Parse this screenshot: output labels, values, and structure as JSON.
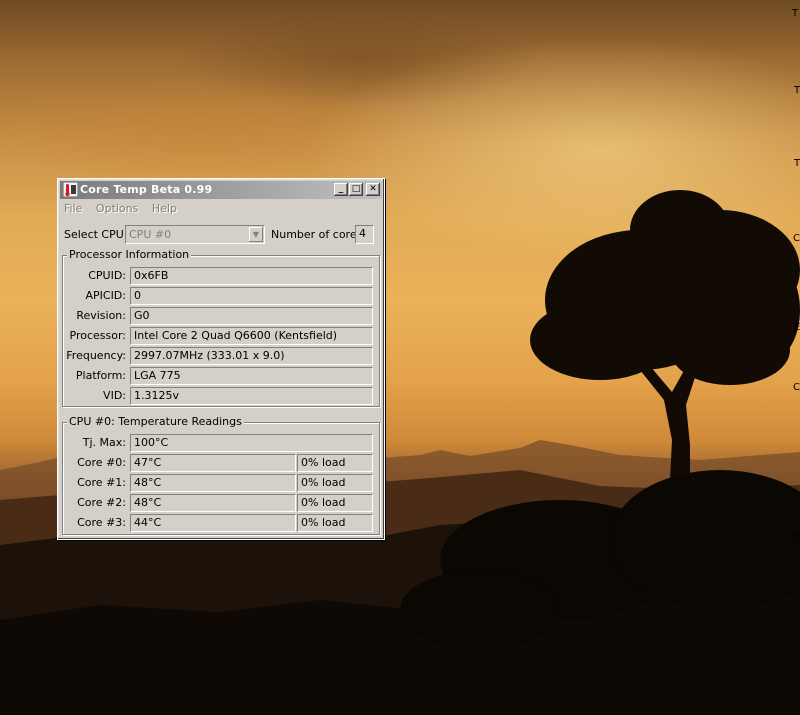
{
  "window": {
    "title": "Core Temp Beta 0.99",
    "controls": {
      "minimize": "_",
      "maximize": "□",
      "close": "✕"
    }
  },
  "menu": [
    "File",
    "Options",
    "Help"
  ],
  "select_cpu": {
    "label": "Select CPU:",
    "value": "CPU #0"
  },
  "cores": {
    "label": "Number of cores",
    "value": "4"
  },
  "processor_info": {
    "title": "Processor Information",
    "rows": [
      {
        "label": "CPUID:",
        "value": "0x6FB"
      },
      {
        "label": "APICID:",
        "value": "0"
      },
      {
        "label": "Revision:",
        "value": "G0"
      },
      {
        "label": "Processor:",
        "value": "Intel Core 2 Quad Q6600 (Kentsfield)"
      },
      {
        "label": "Frequency:",
        "value": "2997.07MHz (333.01 x 9.0)"
      },
      {
        "label": "Platform:",
        "value": "LGA 775"
      },
      {
        "label": "VID:",
        "value": "1.3125v"
      }
    ]
  },
  "temps": {
    "title": "CPU #0: Temperature Readings",
    "tjmax": {
      "label": "Tj. Max:",
      "value": "100°C"
    },
    "cores": [
      {
        "label": "Core #0:",
        "temp": "47°C",
        "load": "0% load"
      },
      {
        "label": "Core #1:",
        "temp": "48°C",
        "load": "0% load"
      },
      {
        "label": "Core #2:",
        "temp": "48°C",
        "load": "0% load"
      },
      {
        "label": "Core #3:",
        "temp": "44°C",
        "load": "0% load"
      }
    ]
  },
  "desktop_edge_text": [
    "T",
    "T",
    "T",
    "C",
    "E",
    "C",
    "C"
  ]
}
